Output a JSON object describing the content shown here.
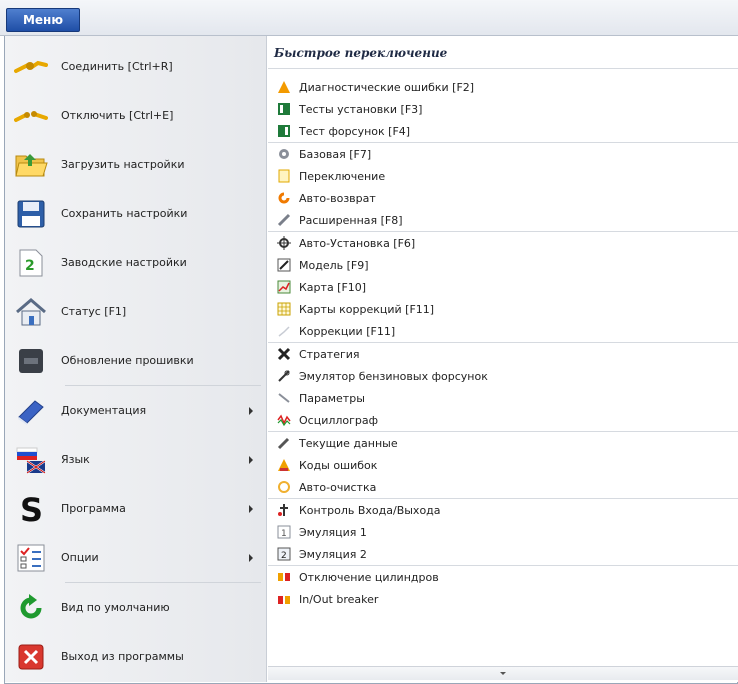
{
  "topbar": {
    "menu_label": "Меню"
  },
  "left_menu": {
    "items": [
      {
        "label": "Соединить [Ctrl+R]",
        "icon": "plug-connect-icon",
        "submenu": false
      },
      {
        "label": "Отключить [Ctrl+E]",
        "icon": "plug-disconnect-icon",
        "submenu": false
      },
      {
        "label": "Загрузить настройки",
        "icon": "folder-open-icon",
        "submenu": false
      },
      {
        "label": "Сохранить настройки",
        "icon": "floppy-disk-icon",
        "submenu": false
      },
      {
        "label": "Заводские настройки",
        "icon": "factory-reset-icon",
        "submenu": false
      },
      {
        "label": "Статус [F1]",
        "icon": "house-icon",
        "submenu": false
      },
      {
        "label": "Обновление прошивки",
        "icon": "firmware-chip-icon",
        "submenu": false
      },
      {
        "label": "Документация",
        "icon": "book-icon",
        "submenu": true
      },
      {
        "label": "Язык",
        "icon": "flags-icon",
        "submenu": true
      },
      {
        "label": "Программа",
        "icon": "s-logo-icon",
        "submenu": true
      },
      {
        "label": "Опции",
        "icon": "checklist-icon",
        "submenu": true
      },
      {
        "label": "Вид по умолчанию",
        "icon": "refresh-arrow-icon",
        "submenu": false
      },
      {
        "label": "Выход из программы",
        "icon": "exit-x-icon",
        "submenu": false
      }
    ]
  },
  "quick_switch": {
    "title": "Быстрое переключение",
    "items": [
      {
        "label": "Диагностические ошибки [F2]",
        "icon": "warning-triangle-icon"
      },
      {
        "label": "Тесты установки [F3]",
        "icon": "install-test-icon"
      },
      {
        "label": "Тест форсунок [F4]",
        "icon": "injector-test-icon"
      },
      {
        "label": "Базовая [F7]",
        "icon": "base-settings-icon"
      },
      {
        "label": "Переключение",
        "icon": "switching-icon"
      },
      {
        "label": "Авто-возврат",
        "icon": "auto-return-icon"
      },
      {
        "label": "Расширенная [F8]",
        "icon": "advanced-settings-icon"
      },
      {
        "label": "Авто-Установка [F6]",
        "icon": "auto-setup-icon"
      },
      {
        "label": "Модель [F9]",
        "icon": "model-icon"
      },
      {
        "label": "Карта [F10]",
        "icon": "map-chart-icon"
      },
      {
        "label": "Карты коррекций [F11]",
        "icon": "correction-maps-icon"
      },
      {
        "label": "Коррекции [F11]",
        "icon": "corrections-icon"
      },
      {
        "label": "Стратегия",
        "icon": "strategy-icon"
      },
      {
        "label": "Эмулятор бензиновых форсунок",
        "icon": "injector-emulator-icon"
      },
      {
        "label": "Параметры",
        "icon": "parameters-icon"
      },
      {
        "label": "Осциллограф",
        "icon": "oscilloscope-icon"
      },
      {
        "label": "Текущие данные",
        "icon": "current-data-icon"
      },
      {
        "label": "Коды ошибок",
        "icon": "error-codes-icon"
      },
      {
        "label": "Авто-очистка",
        "icon": "auto-clean-icon"
      },
      {
        "label": "Контроль Входа/Выхода",
        "icon": "io-control-icon"
      },
      {
        "label": "Эмуляция 1",
        "icon": "emulation1-icon"
      },
      {
        "label": "Эмуляция 2",
        "icon": "emulation2-icon"
      },
      {
        "label": "Отключение цилиндров",
        "icon": "cylinder-off-icon"
      },
      {
        "label": "In/Out breaker",
        "icon": "io-breaker-icon"
      }
    ]
  }
}
